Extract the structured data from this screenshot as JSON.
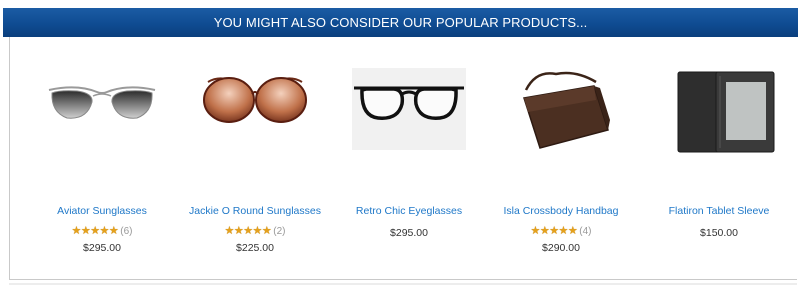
{
  "banner": {
    "title": "YOU MIGHT ALSO CONSIDER OUR POPULAR PRODUCTS..."
  },
  "products": [
    {
      "name": "Aviator Sunglasses",
      "stars": "★★★★★",
      "rating_value": 4.5,
      "review_count": "(6)",
      "price": "$295.00"
    },
    {
      "name": "Jackie O Round Sunglasses",
      "stars": "★★★★★",
      "rating_value": 5,
      "review_count": "(2)",
      "price": "$225.00"
    },
    {
      "name": "Retro Chic Eyeglasses",
      "price": "$295.00"
    },
    {
      "name": "Isla Crossbody Handbag",
      "stars": "★★★★★",
      "rating_value": 4.5,
      "review_count": "(4)",
      "price": "$290.00"
    },
    {
      "name": "Flatiron Tablet Sleeve",
      "price": "$150.00"
    }
  ],
  "colors": {
    "banner": "#0f4c92",
    "link": "#1f78c8",
    "star": "#e5a11c"
  }
}
